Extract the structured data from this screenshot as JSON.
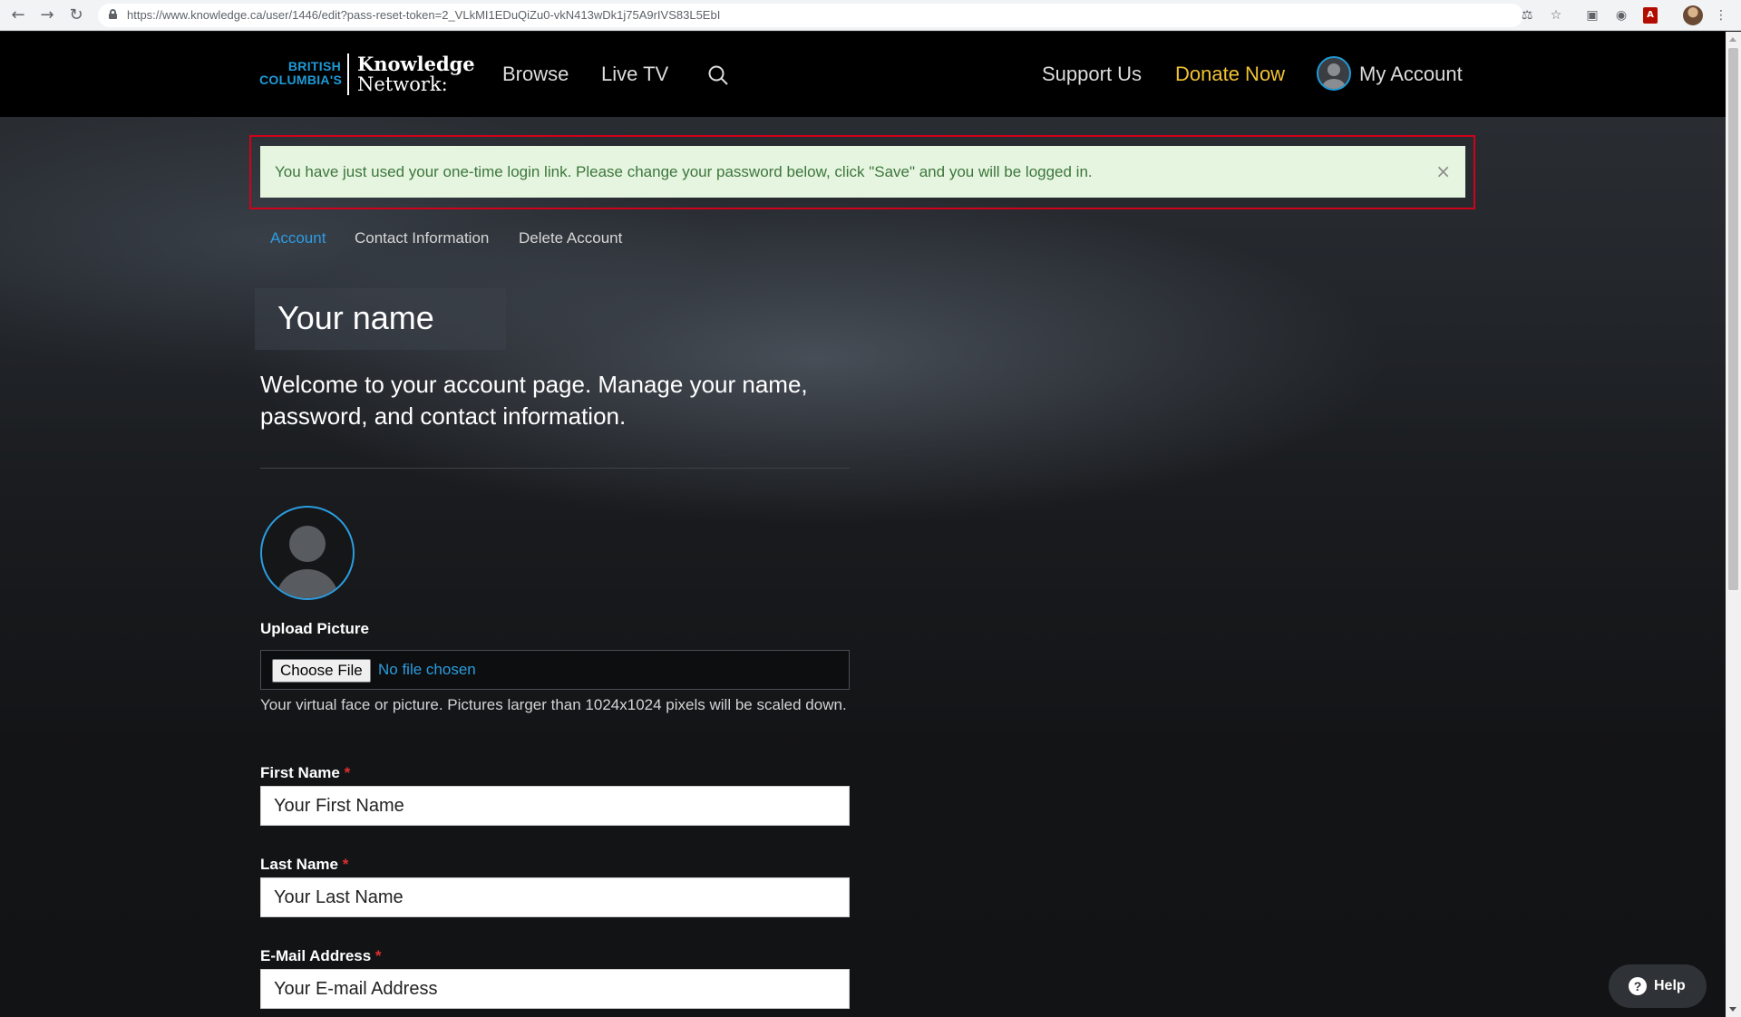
{
  "browser": {
    "url": "https://www.knowledge.ca/user/1446/edit?pass-reset-token=2_VLkMI1EDuQiZu0-vkN413wDk1j75A9rIVS83L5EbI"
  },
  "header": {
    "logo_bc": "BRITISH COLUMBIA'S",
    "logo_line1": "Knowledge",
    "logo_line2": "Network:",
    "nav": {
      "browse": "Browse",
      "live_tv": "Live TV",
      "support": "Support Us",
      "donate": "Donate Now",
      "account": "My Account"
    }
  },
  "message": {
    "text": "You have just used your one-time login link. Please change your password below, click \"Save\" and you will be logged in.",
    "close": "×"
  },
  "tabs": [
    "Account",
    "Contact Information",
    "Delete Account"
  ],
  "page_title": "Your name",
  "welcome": "Welcome to your account page. Manage your name, password, and contact information.",
  "upload": {
    "label": "Upload Picture",
    "button": "Choose File",
    "status": "No file chosen",
    "help": "Your virtual face or picture. Pictures larger than 1024x1024 pixels will be scaled down."
  },
  "fields": {
    "first_name": {
      "label": "First Name",
      "required": "*",
      "value": "Your First Name"
    },
    "last_name": {
      "label": "Last Name",
      "required": "*",
      "value": "Your Last Name"
    },
    "email": {
      "label": "E-Mail Address",
      "required": "*",
      "value": "Your E-mail Address"
    }
  },
  "help_button": {
    "icon": "?",
    "label": "Help"
  },
  "colors": {
    "accent_blue": "#2b9de0",
    "donate_gold": "#f1c232",
    "message_bg": "#e6f5df",
    "highlight_red": "#d0021b"
  }
}
